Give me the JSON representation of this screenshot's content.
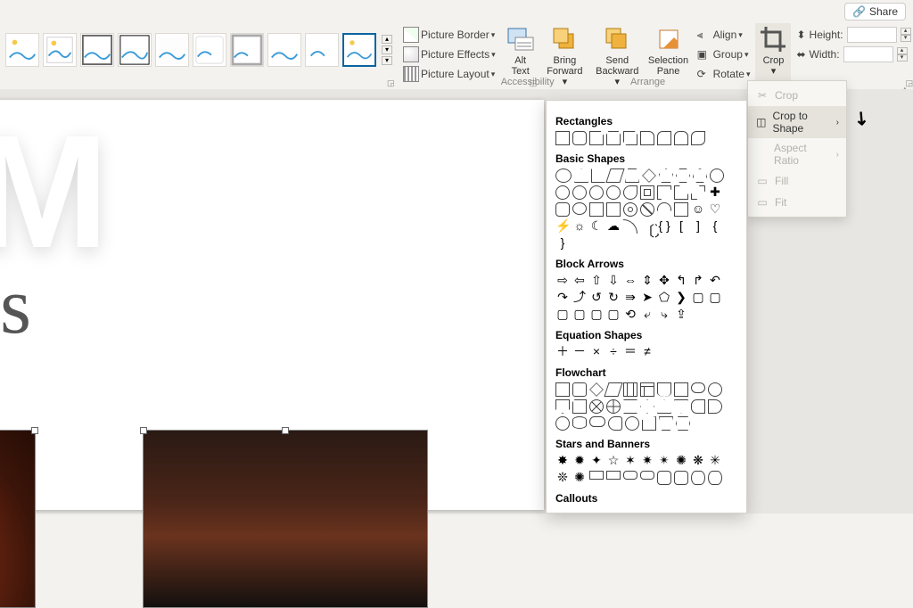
{
  "share": "Share",
  "picture_format": {
    "border": "Picture Border",
    "effects": "Picture Effects",
    "layout": "Picture Layout"
  },
  "alt_text": {
    "line1": "Alt",
    "line2": "Text"
  },
  "accessibility_caption": "Accessibility",
  "arrange": {
    "bring_forward": {
      "line1": "Bring",
      "line2": "Forward"
    },
    "send_backward": {
      "line1": "Send",
      "line2": "Backward"
    },
    "selection_pane": {
      "line1": "Selection",
      "line2": "Pane"
    },
    "align": "Align",
    "group": "Group",
    "rotate": "Rotate",
    "caption": "Arrange"
  },
  "crop_btn": "Crop",
  "size": {
    "height_label": "Height:",
    "width_label": "Width:"
  },
  "crop_menu": {
    "crop": "Crop",
    "crop_to_shape": "Crop to Shape",
    "aspect_ratio": "Aspect Ratio",
    "fill": "Fill",
    "fit": "Fit"
  },
  "shape_headers": {
    "rectangles": "Rectangles",
    "basic": "Basic Shapes",
    "arrows": "Block Arrows",
    "equation": "Equation Shapes",
    "flowchart": "Flowchart",
    "stars": "Stars and Banners",
    "callouts": "Callouts"
  },
  "slide": {
    "big": "MIUM",
    "script": "v the links"
  }
}
